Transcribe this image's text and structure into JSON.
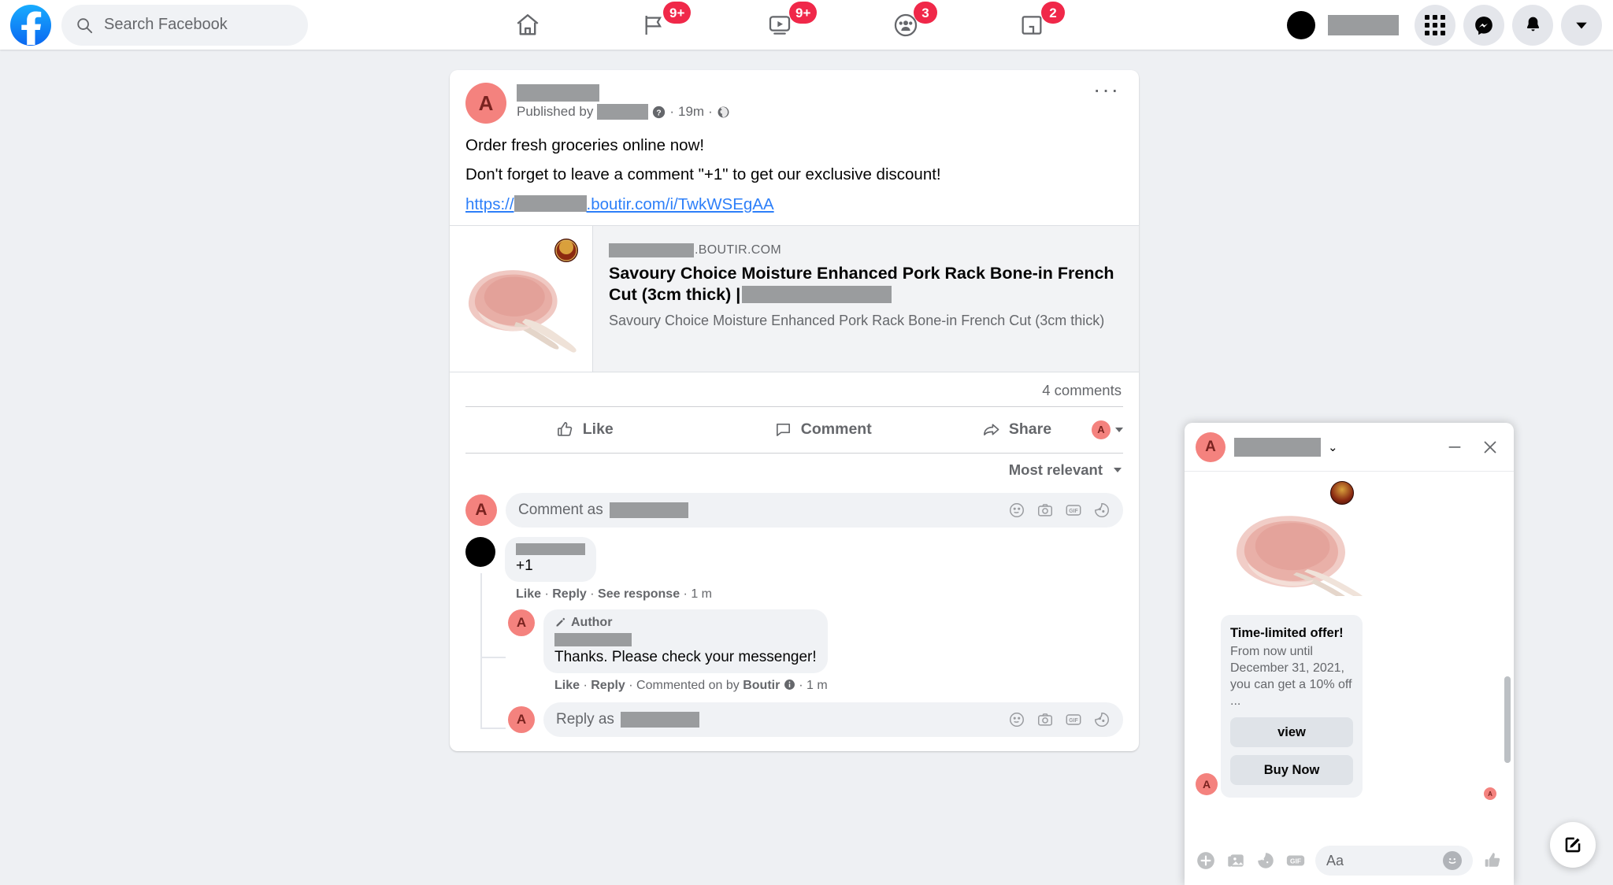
{
  "topbar": {
    "logo_icon": "facebook-logo-icon",
    "search": {
      "placeholder": "Search Facebook",
      "icon": "search-icon"
    },
    "nav": [
      {
        "name": "home",
        "icon": "home-icon",
        "badge": ""
      },
      {
        "name": "pages",
        "icon": "flag-icon",
        "badge": "9+"
      },
      {
        "name": "watch",
        "icon": "watch-video-icon",
        "badge": "9+"
      },
      {
        "name": "groups",
        "icon": "groups-icon",
        "badge": "3"
      },
      {
        "name": "gaming",
        "icon": "gaming-icon",
        "badge": "2"
      }
    ],
    "right": [
      {
        "name": "menu",
        "icon": "apps-grid-icon"
      },
      {
        "name": "messenger",
        "icon": "messenger-icon"
      },
      {
        "name": "notifications",
        "icon": "bell-icon"
      },
      {
        "name": "account",
        "icon": "chevron-down-icon"
      }
    ]
  },
  "post": {
    "avatar_letter": "A",
    "published_by_label": "Published by",
    "help_icon": "question-circle-icon",
    "time": "19m",
    "audience_icon": "globe-icon",
    "menu_icon": "ellipsis-icon",
    "body_line1": "Order fresh groceries online now!",
    "body_line2": "Don't forget to leave a comment \"+1\" to get our exclusive discount!",
    "link_prefix": "https://",
    "link_suffix": ".boutir.com/i/TwkWSEgAA",
    "attachment": {
      "domain_suffix": ".BOUTIR.COM",
      "title_line1": "Savoury Choice Moisture Enhanced Pork Rack Bone-in French",
      "title_line2": "Cut (3cm thick) |",
      "description": "Savoury Choice Moisture Enhanced Pork Rack Bone-in French Cut (3cm thick)",
      "image_alt": "pork-rack-product-photo"
    },
    "comments_count": "4 comments",
    "actions": [
      {
        "name": "like",
        "label": "Like",
        "icon": "thumbs-up-icon"
      },
      {
        "name": "comment",
        "label": "Comment",
        "icon": "comment-bubble-icon"
      },
      {
        "name": "share",
        "label": "Share",
        "icon": "share-arrow-icon"
      }
    ],
    "share_as_letter": "A",
    "sort_label": "Most relevant",
    "comment_box": {
      "prefix": "Comment as",
      "icons": [
        "emoji-icon",
        "camera-icon",
        "gif-icon",
        "sticker-icon"
      ]
    },
    "comments": [
      {
        "avatar": "black",
        "text": "+1",
        "actions": [
          "Like",
          "Reply",
          "See response"
        ],
        "time": "1 m"
      },
      {
        "avatar_letter": "A",
        "author_badge": "Author",
        "author_badge_icon": "pen-icon",
        "text": "Thanks. Please check your messenger!",
        "actions": [
          "Like",
          "Reply"
        ],
        "commented_by_label": "Commented on by",
        "commented_by": "Boutir",
        "info_icon": "info-circle-icon",
        "time": "1 m"
      }
    ],
    "reply_box": {
      "prefix": "Reply as",
      "avatar_letter": "A",
      "icons": [
        "emoji-icon",
        "camera-icon",
        "gif-icon",
        "sticker-icon"
      ]
    }
  },
  "chat": {
    "avatar_letter": "A",
    "chevron_icon": "chevron-down-icon",
    "minimize_icon": "minimize-icon",
    "close_icon": "close-icon",
    "product_image_alt": "pork-rack-product-photo",
    "offer": {
      "title": "Time-limited offer!",
      "description": "From now until December 31, 2021, you can get a 10% off ...",
      "buttons": [
        "view",
        "Buy Now"
      ]
    },
    "sender_avatar_letter": "A",
    "seen_avatar_letter": "A",
    "composer": {
      "icons": [
        "plus-circle-icon",
        "photo-icon",
        "sticker-icon",
        "gif-icon"
      ],
      "placeholder": "Aa",
      "emoji_icon": "emoji-icon",
      "like_icon": "thumbs-up-icon"
    }
  },
  "fab": {
    "icon": "compose-icon"
  },
  "colors": {
    "fb_blue": "#1877F2",
    "badge_red": "#F02849",
    "link_blue": "#2d7ff9",
    "avatar_red": "#F4827E",
    "page_bg": "#eef0f3",
    "secondary_text": "#65676B"
  }
}
